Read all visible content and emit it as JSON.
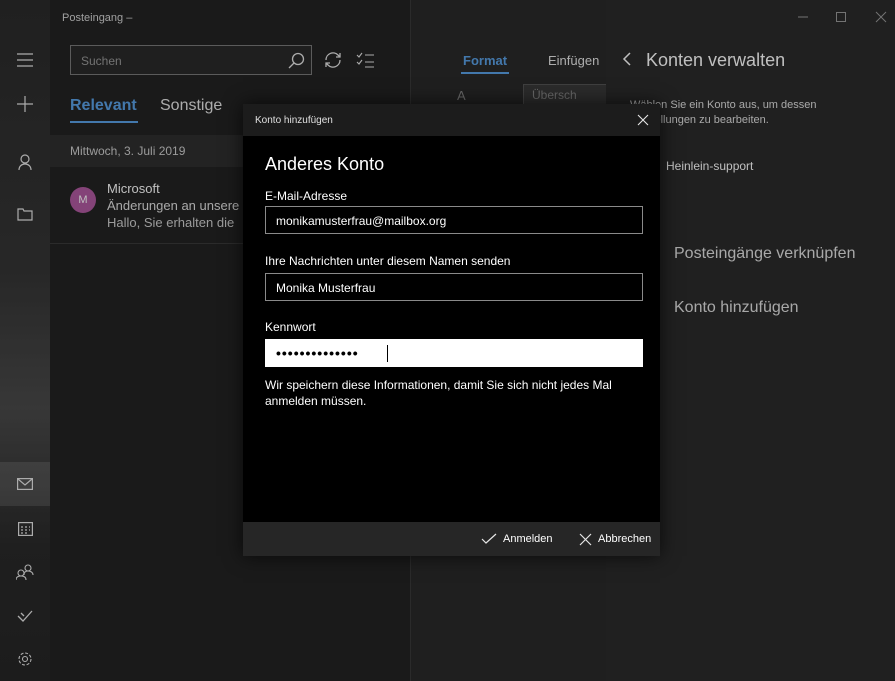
{
  "window": {
    "title": "Posteingang –"
  },
  "search": {
    "placeholder": "Suchen"
  },
  "tabs": {
    "relevant": "Relevant",
    "sonstige": "Sonstige"
  },
  "mail_list": {
    "date_header": "Mittwoch, 3. Juli 2019",
    "items": [
      {
        "avatar": "M",
        "from": "Microsoft",
        "subject": "Änderungen an unsere",
        "preview": "Hallo, Sie erhalten die"
      }
    ]
  },
  "reading": {
    "tab_format": "Format",
    "tab_einfuegen": "Einfügen",
    "format_a": "A",
    "style_label": "Übersch"
  },
  "flyout": {
    "title": "Konten verwalten",
    "description": "Wählen Sie ein Konto aus, um dessen Einstellungen zu bearbeiten.",
    "account": "Heinlein-support",
    "link_inboxes": "Posteingänge verknüpfen",
    "add_account": "Konto hinzufügen"
  },
  "dialog": {
    "titlebar": "Konto hinzufügen",
    "heading": "Anderes Konto",
    "email_label": "E-Mail-Adresse",
    "email_value": "monikamusterfrau@mailbox.org",
    "name_label": "Ihre Nachrichten unter diesem Namen senden",
    "name_value": "Monika Musterfrau",
    "password_label": "Kennwort",
    "password_value": "••••••••••••••",
    "info": "Wir speichern diese Informationen, damit Sie sich nicht jedes Mal anmelden müssen.",
    "signin_label": "Anmelden",
    "cancel_label": "Abbrechen"
  },
  "colors": {
    "accent": "#5aa0e6",
    "avatar": "#b15aa0"
  },
  "icons": [
    "hamburger-icon",
    "plus-icon",
    "person-icon",
    "folder-icon",
    "mail-icon",
    "calendar-icon",
    "people-icon",
    "todo-icon",
    "settings-icon",
    "search-icon",
    "sync-icon",
    "select-icon",
    "close-icon",
    "check-icon",
    "back-icon"
  ]
}
